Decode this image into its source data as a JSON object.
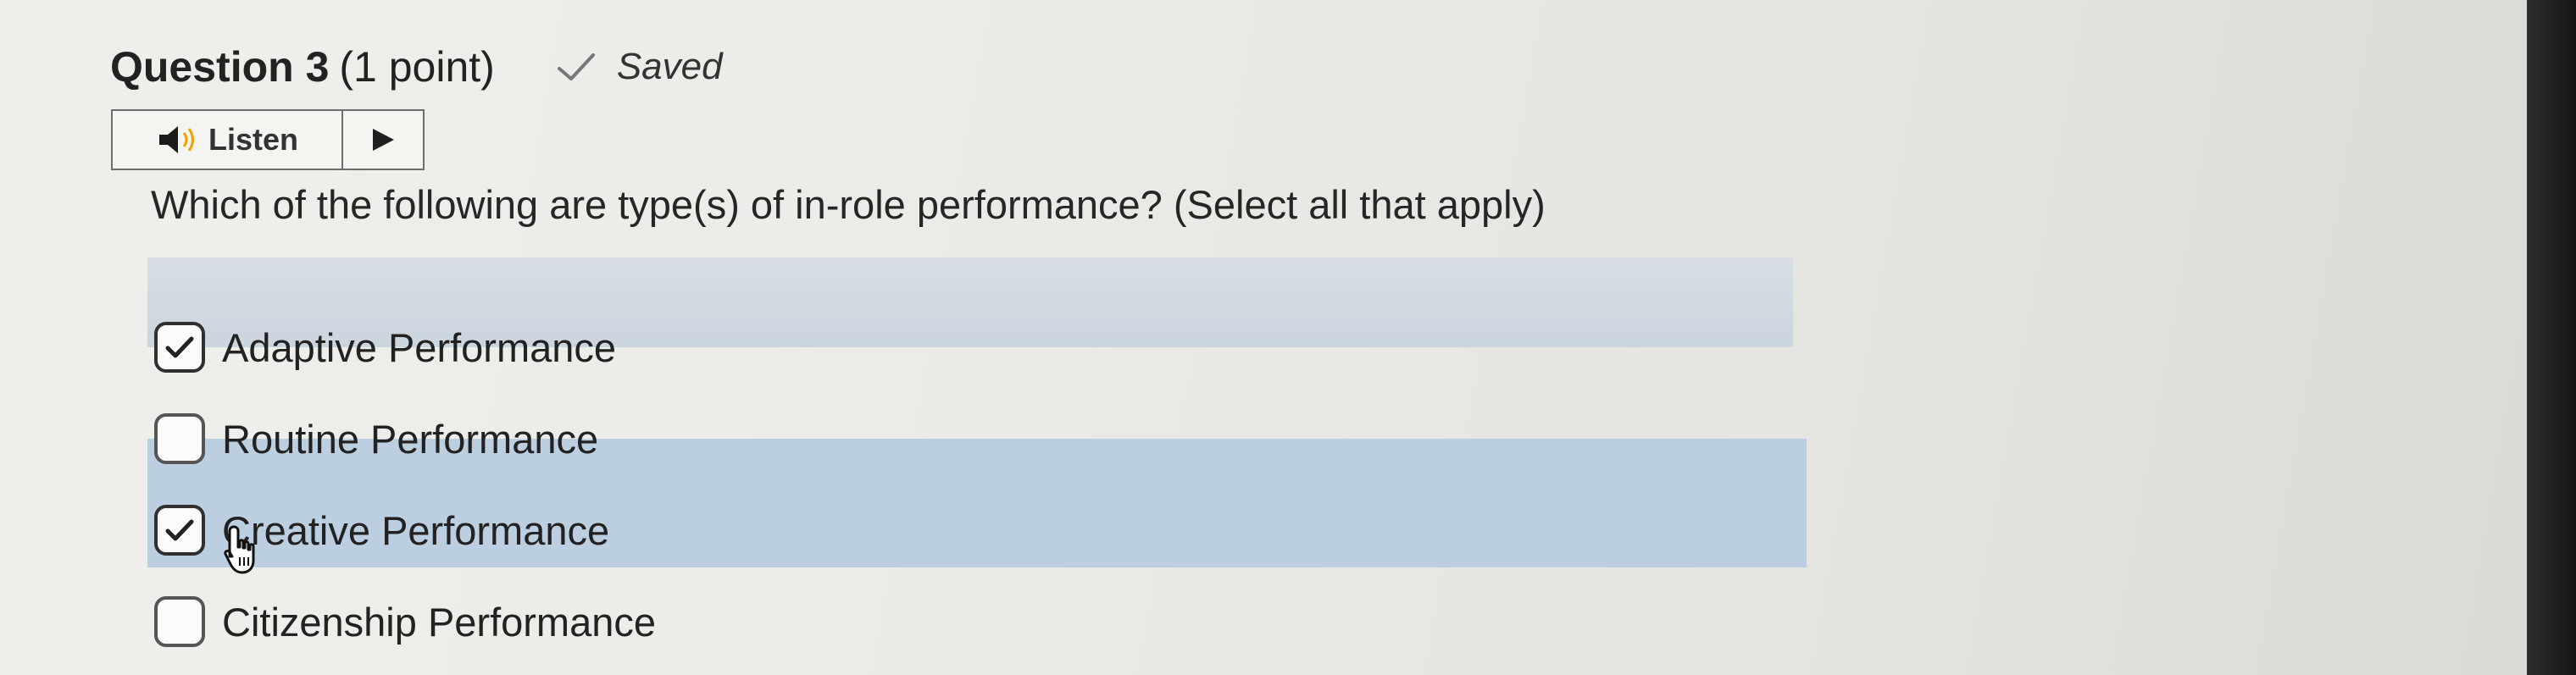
{
  "question": {
    "title": "Question 3",
    "points": "(1 point)",
    "status_icon": "check-icon",
    "status": "Saved",
    "text": "Which of the following are type(s) of in-role performance? (Select all that apply)"
  },
  "listen": {
    "icon": "speaker-icon",
    "label": "Listen",
    "play_icon": "play-icon"
  },
  "options": [
    {
      "label": "Adaptive Performance",
      "checked": true
    },
    {
      "label": "Routine Performance",
      "checked": false
    },
    {
      "label": "Creative Performance",
      "checked": true
    },
    {
      "label": "Citizenship Performance",
      "checked": false
    }
  ],
  "colors": {
    "highlight": "#bccfe0",
    "checkbox_border": "#555555"
  }
}
